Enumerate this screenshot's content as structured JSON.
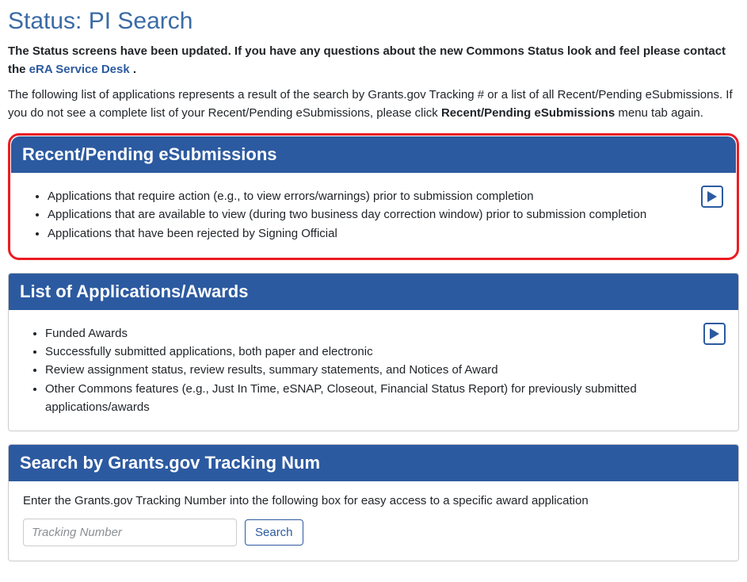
{
  "page": {
    "title": "Status: PI Search",
    "notice_part1": "The Status screens have been updated. If you have any questions about the new Commons Status look and feel please contact the ",
    "notice_link": "eRA Service Desk",
    "notice_part2": " .",
    "intro_part1": "The following list of applications represents a result of the search by Grants.gov Tracking # or a list of all Recent/Pending eSubmissions. If you do not see a complete list of your Recent/Pending eSubmissions, please click ",
    "intro_bold": "Recent/Pending eSubmissions",
    "intro_part2": " menu tab again."
  },
  "panels": {
    "recent": {
      "title": "Recent/Pending eSubmissions",
      "items": [
        "Applications that require action (e.g., to view errors/warnings) prior to submission completion",
        "Applications that are available to view (during two business day correction window) prior to submission completion",
        "Applications that have been rejected by Signing Official"
      ]
    },
    "list": {
      "title": "List of Applications/Awards",
      "items": [
        "Funded Awards",
        "Successfully submitted applications, both paper and electronic",
        "Review assignment status, review results, summary statements, and Notices of Award",
        "Other Commons features (e.g., Just In Time, eSNAP, Closeout, Financial Status Report) for previously submitted applications/awards"
      ]
    },
    "search": {
      "title": "Search by Grants.gov Tracking Num",
      "desc": "Enter the Grants.gov Tracking Number into the following box for easy access to a specific award application",
      "placeholder": "Tracking Number",
      "button": "Search"
    }
  }
}
